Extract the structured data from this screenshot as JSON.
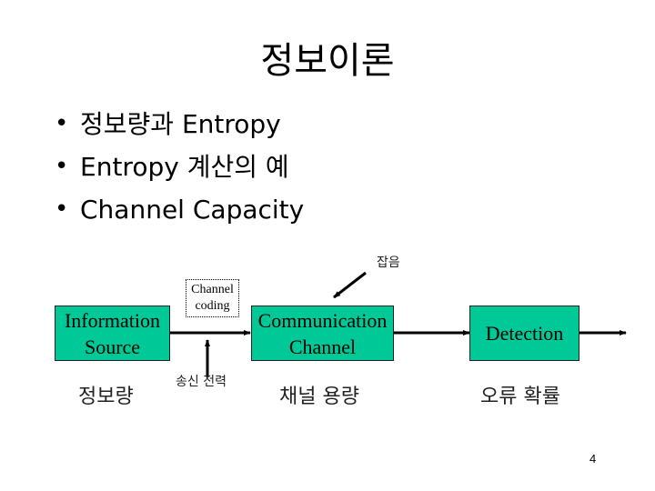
{
  "slide": {
    "title": "정보이론",
    "bullets": [
      "정보량과 Entropy",
      "Entropy 계산의 예",
      "Channel Capacity"
    ],
    "bullet_glyph": "•",
    "page_number": "4"
  },
  "diagram": {
    "box_color": "#00c896",
    "blocks": {
      "source": {
        "line1": "Information",
        "line2": "Source",
        "caption": "정보량"
      },
      "channel": {
        "line1": "Communication",
        "line2": "Channel",
        "caption": "채널 용량"
      },
      "detection": {
        "line1": "Detection",
        "caption": "오류 확률"
      }
    },
    "channel_coding": {
      "line1": "Channel",
      "line2": "coding"
    },
    "transmit_power_label": "송신 전력",
    "noise_label": "잡음"
  }
}
